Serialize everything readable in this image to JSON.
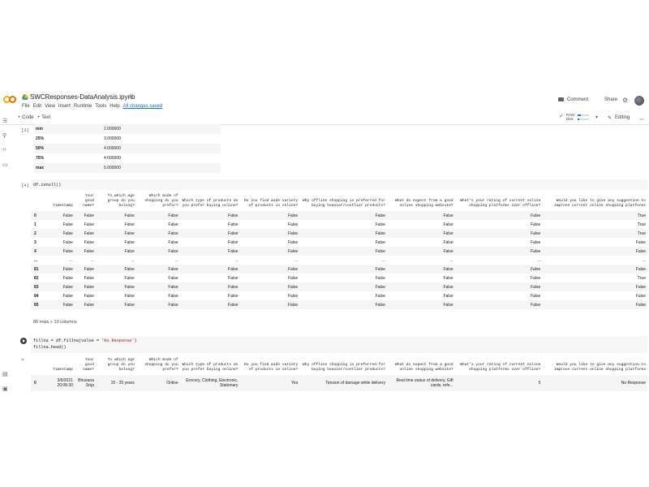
{
  "header": {
    "notebook_name": "SWCResponses-DataAnalysis.ipynb",
    "menu": [
      "File",
      "Edit",
      "View",
      "Insert",
      "Runtime",
      "Tools",
      "Help"
    ],
    "saved_status": "All changes saved",
    "comment_label": "Comment",
    "share_label": "Share"
  },
  "toolbar": {
    "code_label": "+ Code",
    "text_label": "+ Text",
    "ram_label": "RAM",
    "disk_label": "Disk",
    "ram_fraction": 0.25,
    "disk_fraction": 0.15,
    "editing_label": "Editing"
  },
  "cells": {
    "describe": {
      "label": "[3]",
      "rows": [
        {
          "k": "min",
          "v": "2.000000"
        },
        {
          "k": "25%",
          "v": "3.000000"
        },
        {
          "k": "50%",
          "v": "4.000000"
        },
        {
          "k": "75%",
          "v": "4.000000"
        },
        {
          "k": "max",
          "v": "5.000000"
        }
      ]
    },
    "isnull": {
      "label": "[4]",
      "code": "df.isnull()",
      "columns": [
        "",
        "Timestamp",
        "Your good name?",
        "To which age group do you belong?",
        "Which mode of shopping do you prefer?",
        "Which type of products do you prefer buying online?",
        "Do you find wide variety of products in online?",
        "Why offline shopping is preferred for buying heavier/costlier products?",
        "What do expect from a good online shopping website?",
        "What's your rating of current online shopping platforms over offline?",
        "Would you like to give any suggestion to improve current online shopping platforms"
      ],
      "rows": [
        [
          "0",
          "False",
          "False",
          "False",
          "False",
          "False",
          "False",
          "False",
          "False",
          "False",
          "True"
        ],
        [
          "1",
          "False",
          "False",
          "False",
          "False",
          "False",
          "False",
          "False",
          "False",
          "False",
          "True"
        ],
        [
          "2",
          "False",
          "False",
          "False",
          "False",
          "False",
          "False",
          "False",
          "False",
          "False",
          "True"
        ],
        [
          "3",
          "False",
          "False",
          "False",
          "False",
          "False",
          "False",
          "False",
          "False",
          "False",
          "False"
        ],
        [
          "4",
          "False",
          "False",
          "False",
          "False",
          "False",
          "False",
          "False",
          "False",
          "False",
          "False"
        ],
        [
          "...",
          "...",
          "...",
          "...",
          "...",
          "...",
          "...",
          "...",
          "...",
          "...",
          "..."
        ],
        [
          "81",
          "False",
          "False",
          "False",
          "False",
          "False",
          "False",
          "False",
          "False",
          "False",
          "False"
        ],
        [
          "82",
          "False",
          "False",
          "False",
          "False",
          "False",
          "False",
          "False",
          "False",
          "False",
          "True"
        ],
        [
          "83",
          "False",
          "False",
          "False",
          "False",
          "False",
          "False",
          "False",
          "False",
          "False",
          "False"
        ],
        [
          "84",
          "False",
          "False",
          "False",
          "False",
          "False",
          "False",
          "False",
          "False",
          "False",
          "False"
        ],
        [
          "85",
          "False",
          "False",
          "False",
          "False",
          "False",
          "False",
          "False",
          "False",
          "False",
          "False"
        ]
      ],
      "shape_note": "86 rows × 10 columns"
    },
    "fillna": {
      "code_line1_a": "fillna = df.fillna(value = ",
      "code_line1_str": "'No Response'",
      "code_line1_b": ")",
      "code_line2": "fillna.head()",
      "columns": [
        "",
        "Timestamp",
        "Your good name?",
        "To which age group do you belong?",
        "Which mode of shopping do you prefer?",
        "Which type of products do you prefer buying online?",
        "Do you find wide variety of products in online?",
        "Why offline shopping is preferred for buying heavier/costlier products?",
        "What do expect from a good online shopping website?",
        "What's your rating of current online shopping platforms over offline?",
        "Would you like to give any suggestion to improve current online shopping platforms"
      ],
      "row": [
        "0",
        "3/6/2021 20:08:30",
        "Bhuvana Srija",
        "15 - 25 years",
        "Online",
        "Grocery, Clothing, Electronic, Stationary",
        "Yes",
        "Tension of damage while delivery",
        "Real time status of delivery, Gift cards, refe...",
        "5",
        "No Response"
      ]
    }
  }
}
